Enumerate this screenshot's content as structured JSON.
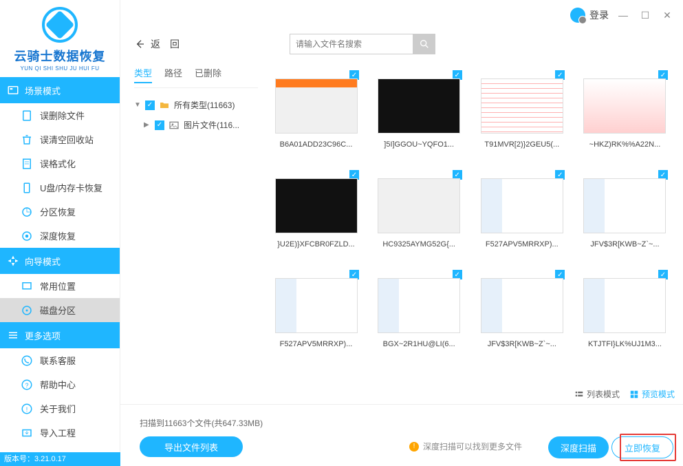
{
  "brand": {
    "title": "云骑士数据恢复",
    "subtitle": "YUN QI SHI SHU JU HUI FU"
  },
  "sections": {
    "scene": "场景模式",
    "guide": "向导模式",
    "more": "更多选项"
  },
  "menu": {
    "misdelete": "误删除文件",
    "recyclebin": "误清空回收站",
    "format": "误格式化",
    "usb": "U盘/内存卡恢复",
    "partition": "分区恢复",
    "deep": "深度恢复",
    "common_loc": "常用位置",
    "disk_part": "磁盘分区",
    "contact": "联系客服",
    "help": "帮助中心",
    "about": "关于我们",
    "import": "导入工程"
  },
  "version_label": "版本号：3.21.0.17",
  "login_label": "登录",
  "back_label": "返　回",
  "search": {
    "placeholder": "请输入文件名搜索"
  },
  "tabs": {
    "type": "类型",
    "path": "路径",
    "deleted": "已删除"
  },
  "tree": {
    "all_types": "所有类型(11663)",
    "images": "图片文件(116..."
  },
  "view": {
    "list": "列表模式",
    "preview": "预览模式"
  },
  "files": [
    "B6A01ADD23C96C...",
    "]5I]GGOU~YQFO1...",
    "T91MVR[2)}2GEU5(...",
    "~HKZ)RK%%A22N...",
    "}U2E)}XFCBR0FZLD...",
    "HC9325AYMG52G{...",
    "F527APV5MRRXP)...",
    "JFV$3R[KWB~Z`~...",
    "F527APV5MRRXP)...",
    "BGX~2R1HU@LI(6...",
    "JFV$3R[KWB~Z`~...",
    "KTJTFI}LK%UJ1M3..."
  ],
  "thumb_styles": [
    "orange-top",
    "dark",
    "redlines",
    "pinkish",
    "dark",
    "",
    "explorer",
    "explorer",
    "explorer",
    "explorer",
    "explorer",
    "explorer"
  ],
  "scan_info": "扫描到11663个文件(共647.33MB)",
  "export_btn": "导出文件列表",
  "deep_hint": "深度扫描可以找到更多文件",
  "deep_btn": "深度扫描",
  "recover_btn": "立即恢复"
}
